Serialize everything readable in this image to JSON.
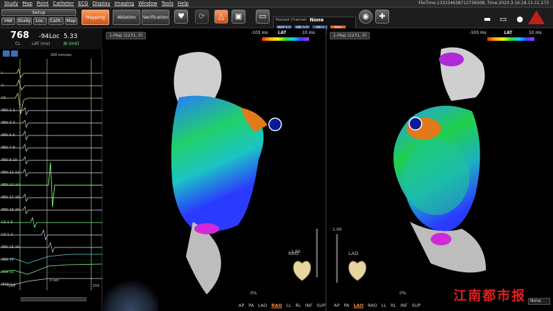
{
  "menu": [
    "Study",
    "Map",
    "Point",
    "Catheter",
    "ECG",
    "Display",
    "Imaging",
    "Window",
    "Tools",
    "Help"
  ],
  "file_time": "FileTime:133234638712736008; Time:2023.3.16.18.11.11.273",
  "setup_label": "Setup",
  "left_tabs": [
    "HW",
    "Study",
    "Loc.",
    "Cath.",
    "Map"
  ],
  "mode_buttons": [
    "Mapping",
    "Ablation",
    "Verification"
  ],
  "routed_channel": {
    "label": "Routed Channel:",
    "value": "None",
    "chips": [
      "MAP 1-2",
      "ABL 1-2",
      "UNI 1",
      "Stim"
    ]
  },
  "ecg": {
    "cycle_length": "768",
    "cl_label": "CL",
    "lat_value": "-94",
    "lat_label": "LAT (ms)",
    "loc_label": "Loc",
    "loc_value": "5.33",
    "bi_label": "Bi (mV)",
    "speed": "200 mm/sec",
    "zero_label": "0 sec",
    "tick_left": "-150",
    "tick_right": "150",
    "leads": [
      "I",
      "II",
      "V1",
      "PEN 1-2",
      "PEN 3-4",
      "PEN 5-6",
      "PEN 7-8",
      "PEN 9-10",
      "PEN 11-12",
      "PEN 13-14",
      "PEN 17-18",
      "PEN 19-20",
      "CS 1-6",
      "CS 1-2",
      "PEN 15-16",
      "PEN 14",
      "PEN 15",
      "MAP 1-2"
    ]
  },
  "left_view": {
    "map_tag": "1-Map (2231, 0)",
    "scale_min": "-103 ms",
    "scale_title": "LAT",
    "scale_max": "10 ms",
    "orientation": "RAO",
    "nav": [
      "AP",
      "PA",
      "LAO",
      "RAO",
      "LL",
      "RL",
      "INF",
      "SUP"
    ],
    "selected": "RAO",
    "zoom_pct": "0%",
    "slider_top": "1.00"
  },
  "right_view": {
    "map_tag": "1-Map (2231, 0)",
    "scale_min": "-103 ms",
    "scale_title": "LAT",
    "scale_max": "10 ms",
    "orientation": "LAO",
    "nav": [
      "AP",
      "PA",
      "LAO",
      "RAO",
      "LL",
      "RL",
      "INF",
      "SUP"
    ],
    "selected": "LAO",
    "zoom_pct": "0%",
    "slider_top": "1.00"
  },
  "watermark": "江南都市报",
  "none_dropdown": "None",
  "colors": {
    "accent": "#e2662a",
    "panel": "#1d1d1d"
  }
}
